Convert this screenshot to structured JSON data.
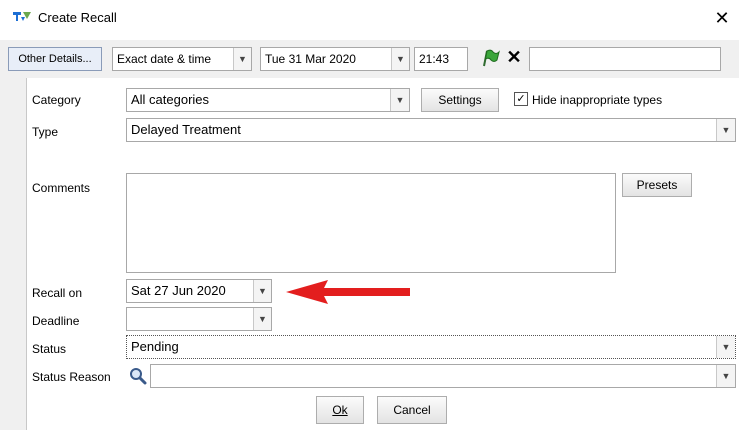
{
  "window": {
    "title": "Create Recall",
    "close_glyph": "✕"
  },
  "toolbar": {
    "other_details_label": "Other Details...",
    "date_mode": "Exact date & time",
    "date": "Tue 31 Mar 2020",
    "time": "21:43",
    "cancel_glyph": "✕",
    "extra_value": ""
  },
  "form": {
    "category": {
      "label": "Category",
      "value": "All categories"
    },
    "settings_label": "Settings",
    "hide_types": {
      "label": "Hide inappropriate types",
      "checked": true
    },
    "type": {
      "label": "Type",
      "value": "Delayed Treatment"
    },
    "comments": {
      "label": "Comments",
      "value": ""
    },
    "presets_label": "Presets",
    "recall_on": {
      "label": "Recall on",
      "value": "Sat 27 Jun 2020"
    },
    "deadline": {
      "label": "Deadline",
      "value": ""
    },
    "status": {
      "label": "Status",
      "value": "Pending"
    },
    "status_reason": {
      "label": "Status Reason",
      "value": ""
    }
  },
  "buttons": {
    "ok_label": "Ok",
    "cancel_label": "Cancel"
  },
  "colors": {
    "annotation_arrow": "#e31e1e",
    "flag_icon": "#3aa63a",
    "app_logo": "#1d6fd4"
  },
  "icons": {
    "app": "app-logo-icon",
    "flag": "flag-icon",
    "search": "magnifier-icon",
    "dropdown": "chevron-down-icon"
  }
}
